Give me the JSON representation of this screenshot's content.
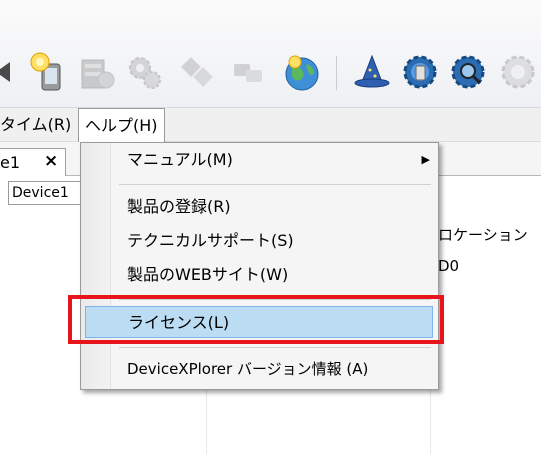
{
  "menubar": {
    "partial_menu_label": "タイム(R)",
    "help_menu_label": "ヘルプ(H)"
  },
  "tab": {
    "label": "e1",
    "close": "×"
  },
  "device_field": {
    "value": "Device1"
  },
  "content": {
    "location_header": "ロケーション",
    "location_value": "D0"
  },
  "help_menu": {
    "items": [
      {
        "label": "マニュアル(M)",
        "has_submenu": true,
        "submenu_arrow": "▶"
      },
      {
        "label": "製品の登録(R)"
      },
      {
        "label": "テクニカルサポート(S)"
      },
      {
        "label": "製品のWEBサイト(W)"
      },
      {
        "label": "ライセンス(L)",
        "highlighted": true
      },
      {
        "label": "DeviceXPlorer バージョン情報 (A)"
      }
    ]
  },
  "toolbar": {
    "icons": [
      "arrow-icon",
      "lightbulb-device-icon",
      "disabled-server-icon",
      "disabled-gears-icon",
      "disabled-tools-icon",
      "disabled-link-icon",
      "globe-icon",
      "wizard-hat-icon",
      "gear-device-icon",
      "gear-search-icon",
      "disabled-gear-icon"
    ]
  },
  "colors": {
    "highlight_fill": "#bcdcf4",
    "highlight_border": "#7eb4ea",
    "annotation_box": "#e8141c"
  }
}
